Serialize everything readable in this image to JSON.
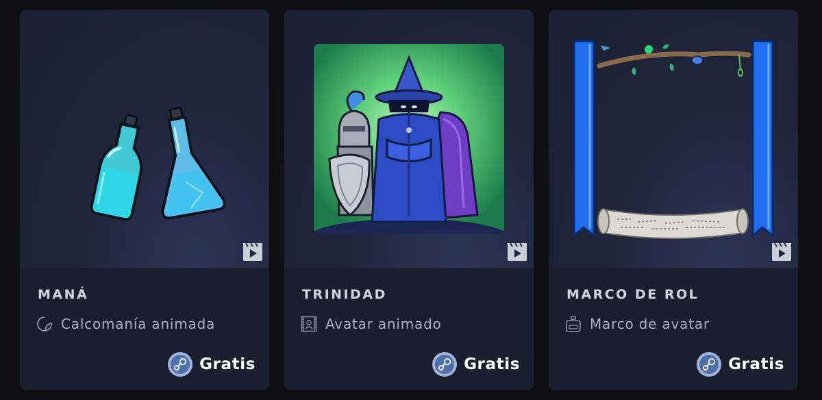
{
  "items": [
    {
      "name": "MANÁ",
      "type_label": "Calcomanía animada",
      "type_icon": "sticker-icon",
      "price": "Gratis"
    },
    {
      "name": "TRINIDAD",
      "type_label": "Avatar animado",
      "type_icon": "animated-avatar-icon",
      "price": "Gratis"
    },
    {
      "name": "MARCO DE ROL",
      "type_label": "Marco de avatar",
      "type_icon": "avatar-frame-icon",
      "price": "Gratis"
    }
  ],
  "colors": {
    "page_bg": "#101014",
    "card_bg": "#1d2233",
    "title_text": "#cfd6e4",
    "type_text": "#aab3c5",
    "price_text": "#ffffff",
    "banner_blue": "#1f6ef0"
  }
}
